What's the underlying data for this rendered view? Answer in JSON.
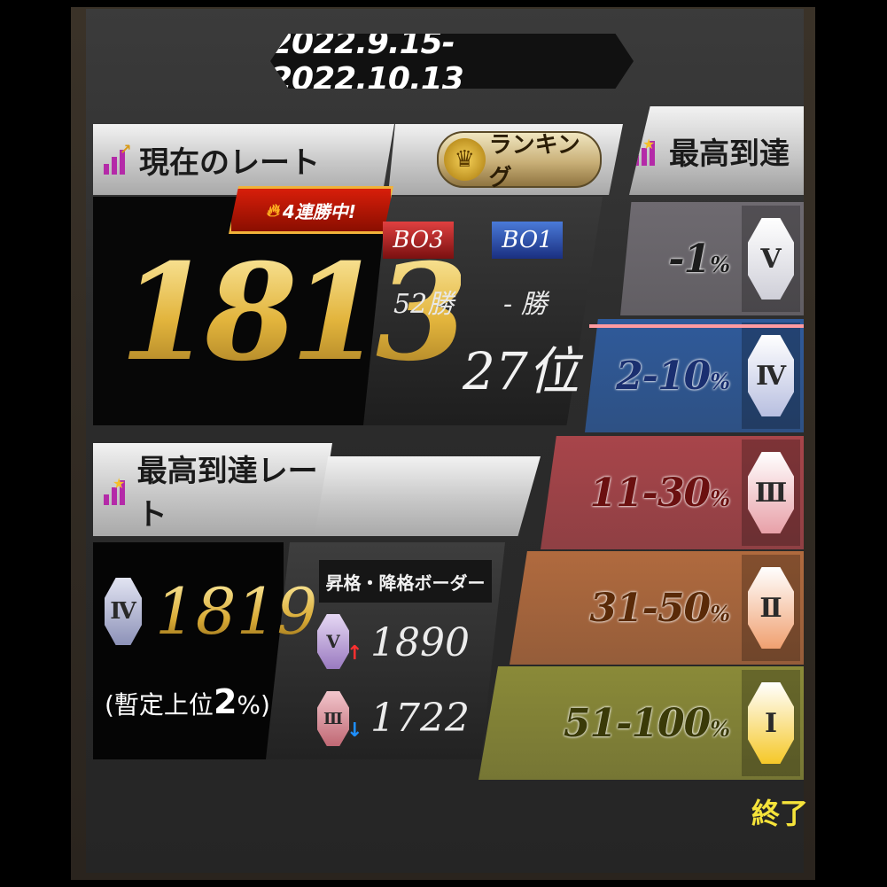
{
  "period": "2022.9.15-2022.10.13",
  "current_rate": {
    "title": "現在のレート",
    "value": "1813",
    "streak_label": "4連勝中!",
    "ranking_button": "ランキング",
    "bo3_label": "BO3",
    "bo1_label": "BO1",
    "bo3_wins": "52勝",
    "bo1_wins": "- 勝",
    "rank": "27位"
  },
  "max_rate": {
    "title": "最高到達レート",
    "tier": "Ⅳ",
    "value": "1819",
    "provisional_prefix": "(暫定上位",
    "provisional_value": "2",
    "provisional_suffix": "%)",
    "border_title": "昇格・降格ボーダー",
    "promote_tier": "Ⅴ",
    "promote_value": "1890",
    "demote_tier": "Ⅲ",
    "demote_value": "1722"
  },
  "max_reached_column": {
    "title": "最高到達",
    "tiers": [
      {
        "range": "-1",
        "pct": "%",
        "badge": "Ⅴ",
        "bg": "#6e6a70",
        "text": "#1c1c1c",
        "badge_color": "#cfcfd8"
      },
      {
        "range": "2-10",
        "pct": "%",
        "badge": "Ⅳ",
        "bg": "#2f5a9a",
        "text": "#1a2f70",
        "badge_color": "#b8bfe0"
      },
      {
        "range": "11-30",
        "pct": "%",
        "badge": "Ⅲ",
        "bg": "#a8454a",
        "text": "#6b1010",
        "badge_color": "#e8a0a8"
      },
      {
        "range": "31-50",
        "pct": "%",
        "badge": "Ⅱ",
        "bg": "#b06a3e",
        "text": "#5a2a08",
        "badge_color": "#f0a070"
      },
      {
        "range": "51-100",
        "pct": "%",
        "badge": "Ⅰ",
        "bg": "#8a8a38",
        "text": "#3a3a08",
        "badge_color": "#f5c828"
      }
    ]
  },
  "end_button": "終了"
}
